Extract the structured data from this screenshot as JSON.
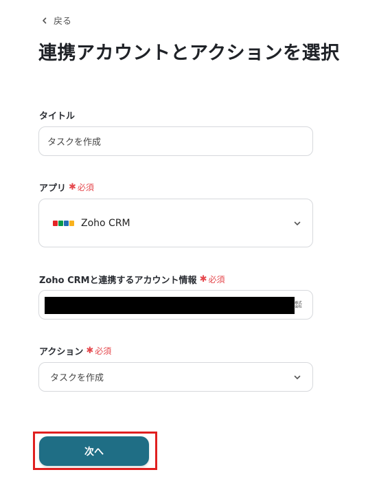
{
  "nav": {
    "back_label": "戻る"
  },
  "page": {
    "title": "連携アカウントとアクションを選択"
  },
  "form": {
    "title_field": {
      "label": "タイトル",
      "value": "タスクを作成"
    },
    "app_field": {
      "label": "アプリ",
      "required": "必須",
      "value": "Zoho CRM",
      "icon": "zoho-logo"
    },
    "account_field": {
      "label": "Zoho CRMと連携するアカウント情報",
      "required": "必須",
      "trailing": "㍿"
    },
    "action_field": {
      "label": "アクション",
      "required": "必須",
      "value": "タスクを作成"
    }
  },
  "submit": {
    "label": "次へ",
    "accent": "#1f6e85",
    "highlight": "#e01f1f"
  },
  "colors": {
    "required": "#e5484d",
    "zoho": [
      "#e42527",
      "#089949",
      "#226db4",
      "#f9b21d"
    ]
  }
}
